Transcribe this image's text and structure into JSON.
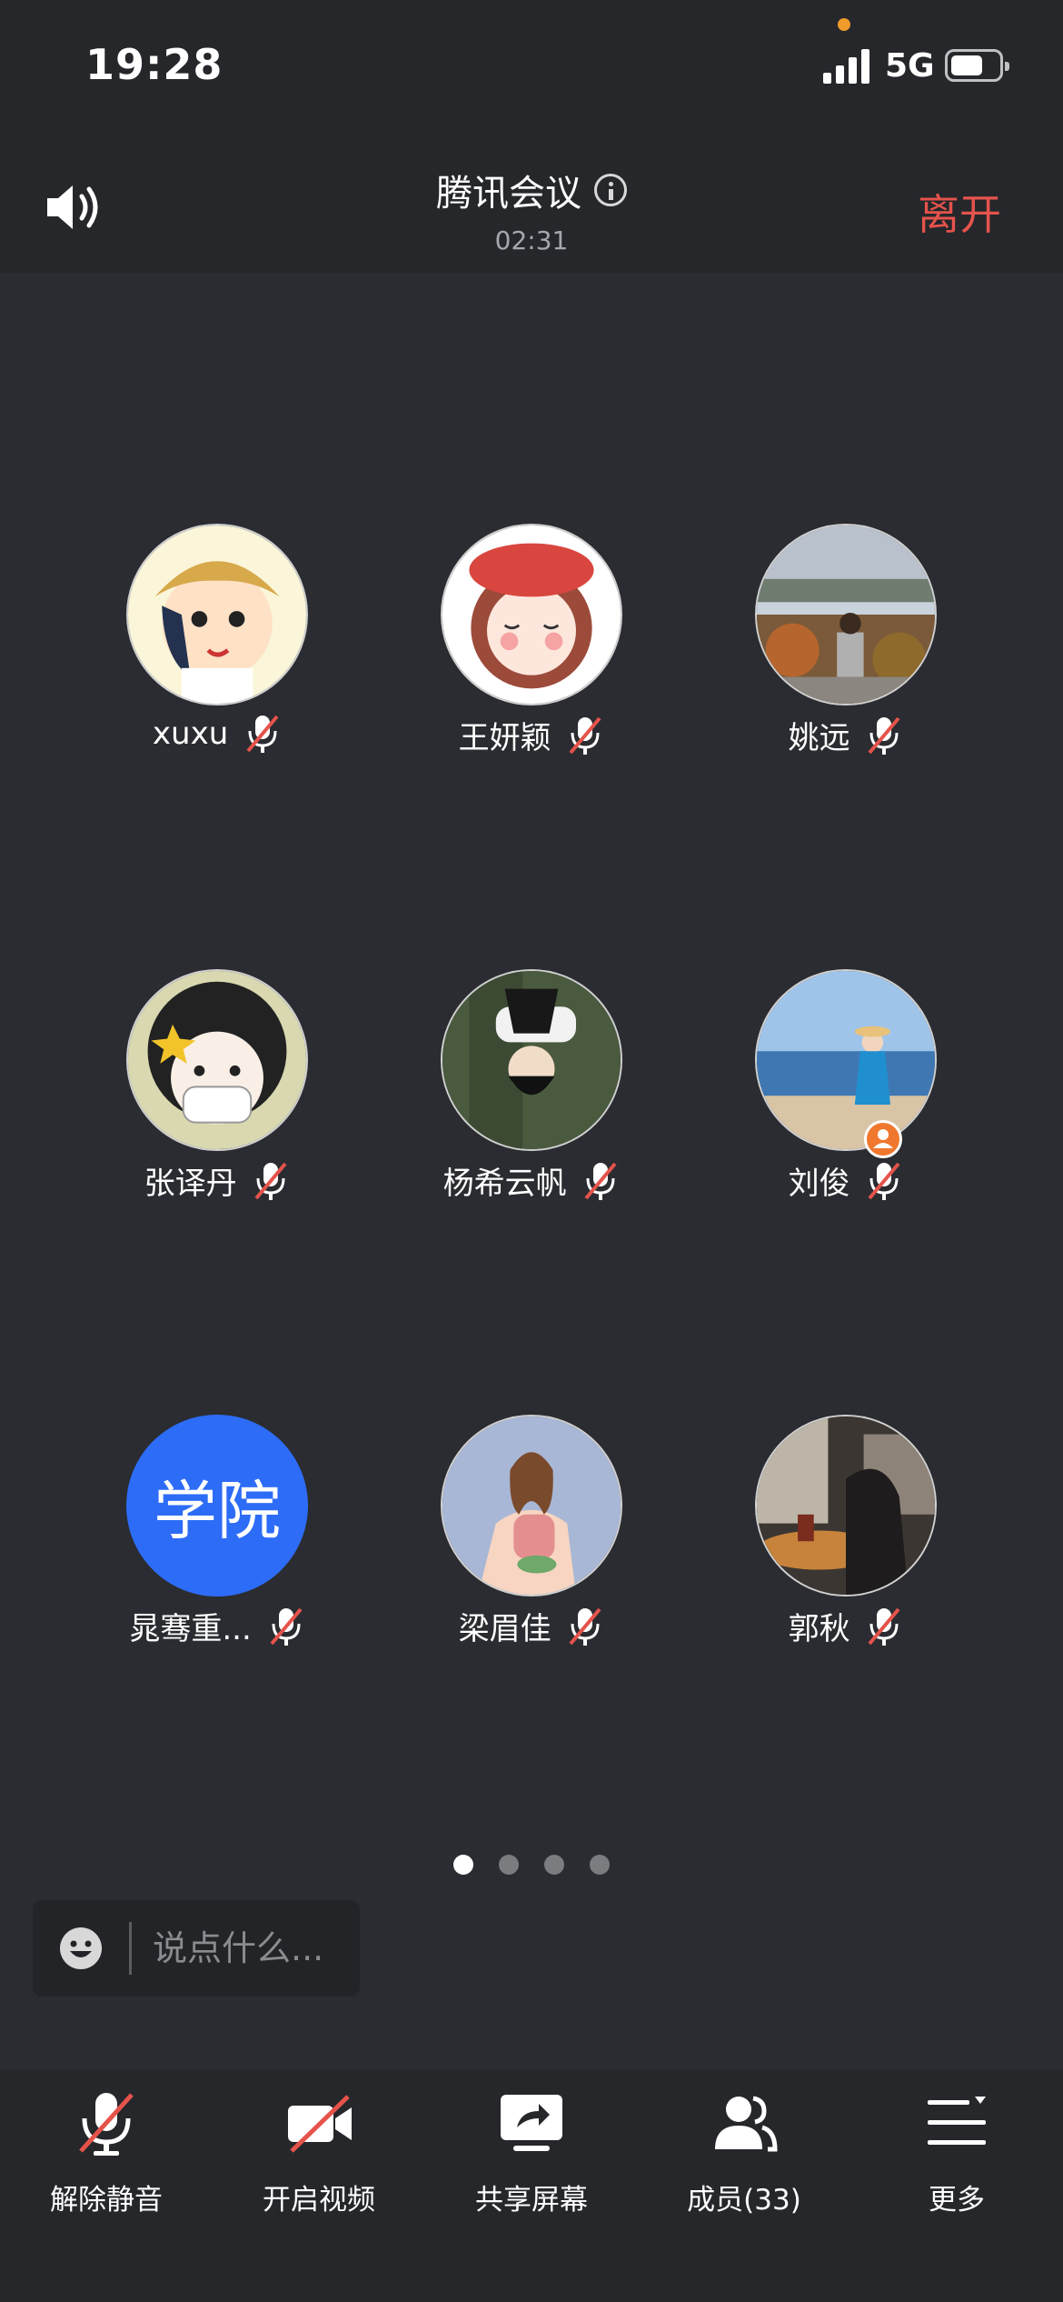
{
  "status_bar": {
    "time": "19:28",
    "network": "5G"
  },
  "header": {
    "title": "腾讯会议",
    "elapsed": "02:31",
    "leave_label": "离开"
  },
  "participants": [
    {
      "name": "xuxu",
      "avatar": "cartoon-boy"
    },
    {
      "name": "王妍颖",
      "avatar": "cartoon-girl"
    },
    {
      "name": "姚远",
      "avatar": "landscape-photo"
    },
    {
      "name": "张译丹",
      "avatar": "curly-cartoon"
    },
    {
      "name": "杨希云帆",
      "avatar": "grass-photo"
    },
    {
      "name": "刘俊",
      "avatar": "beach-photo",
      "is_host": true
    },
    {
      "name": "晁骞重...",
      "avatar_text": "学院"
    },
    {
      "name": "梁眉佳",
      "avatar": "illustration"
    },
    {
      "name": "郭秋",
      "avatar": "cafe-photo"
    }
  ],
  "pager": {
    "pages": 4,
    "current": 1
  },
  "chat": {
    "placeholder": "说点什么..."
  },
  "toolbar": [
    {
      "label": "解除静音",
      "icon": "mic-muted-icon"
    },
    {
      "label": "开启视频",
      "icon": "video-off-icon"
    },
    {
      "label": "共享屏幕",
      "icon": "share-screen-icon"
    },
    {
      "label": "成员(33)",
      "icon": "members-icon"
    },
    {
      "label": "更多",
      "icon": "more-icon"
    }
  ],
  "colors": {
    "leave": "#e5534b",
    "accent_blue": "#2d6cf6",
    "mute_slash": "#e5534b"
  }
}
